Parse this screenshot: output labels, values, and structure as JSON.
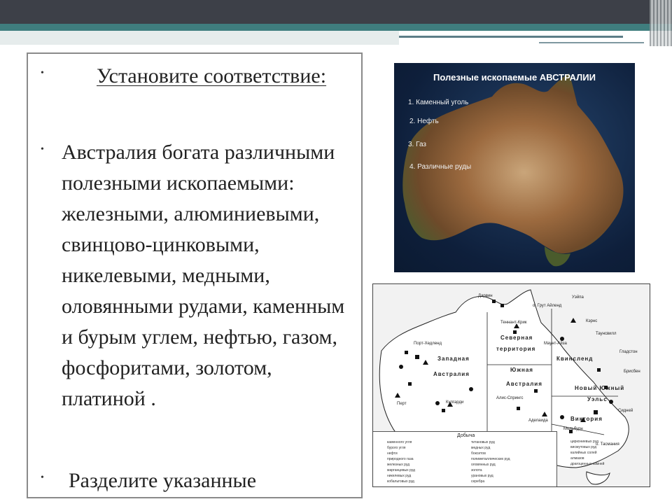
{
  "slide": {
    "bullets": [
      "Установите соответствие:",
      "Австралия богата различными полезными ископаемыми: железными, алюминиевыми, свинцово-цинковыми, никелевыми, медными, оловянными рудами, каменным и бурым углем, нефтью, газом, фосфоритами, золотом, платиной .",
      "Разделите указанные"
    ]
  },
  "satellite_map": {
    "title": "Полезные ископаемые АВСТРАЛИИ",
    "legend": [
      "1. Каменный уголь",
      "2. Нефть",
      "3. Газ",
      "4. Различные руды"
    ]
  },
  "mineral_map": {
    "regions": {
      "nt_line1": "Северная",
      "nt_line2": "территория",
      "wa_line1": "Западная",
      "wa_line2": "Австралия",
      "sa_line1": "Южная",
      "sa_line2": "Австралия",
      "qld": "Квинсленд",
      "nsw": "Новый Южный",
      "nsw2": "Уэльс",
      "vic": "Виктория",
      "tas": "о. Тасмания"
    },
    "cities": [
      "Дарвин",
      "о. Грут Айленд",
      "Теннант-Крик",
      "Маунт-Айза",
      "Порт-Хедленд",
      "Кэрнс",
      "Гладстон",
      "Брисбен",
      "Перт",
      "Кулгарди",
      "Аделаида",
      "Мельбурн",
      "Сидней",
      "Таунсвилл",
      "Уэйпа",
      "Алис-Спрингс"
    ],
    "legend_title": "Добыча",
    "legend_items": [
      "каменного угля",
      "бурого угля",
      "нефти",
      "природного газа",
      "железных руд",
      "марганцевых руд",
      "никелевых руд",
      "кобальтовых руд",
      "титановых руд",
      "медных руд",
      "бокситов",
      "полиметаллических руд",
      "оловянных руд",
      "золота",
      "урановых руд",
      "серебра",
      "циркониевых руд",
      "висмутовых руд",
      "калийных солей",
      "алмазов",
      "драгоценных камней"
    ]
  }
}
